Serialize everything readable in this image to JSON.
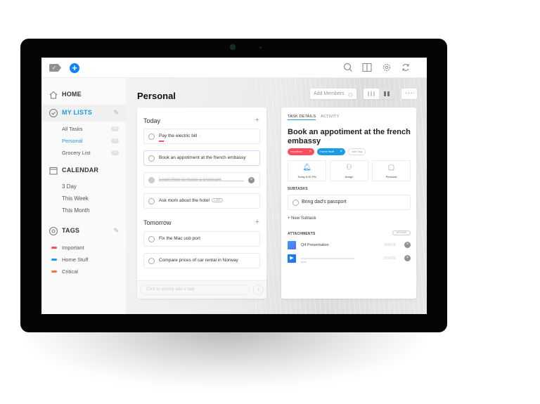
{
  "app": {
    "logo_glyph": "✓",
    "add_glyph": "+",
    "toolbar_icons": [
      "search-icon",
      "book-icon",
      "gear-icon",
      "sync-icon"
    ]
  },
  "sidebar": {
    "home": {
      "label": "HOME",
      "icon": "home-icon"
    },
    "my_lists": {
      "label": "MY LISTS",
      "icon": "check-circle-icon",
      "items": [
        {
          "label": "All Tasks",
          "count": "14"
        },
        {
          "label": "Personal",
          "count": "8",
          "active": true
        },
        {
          "label": "Grocery List",
          "count": "6"
        }
      ]
    },
    "calendar": {
      "label": "CALENDAR",
      "icon": "calendar-icon",
      "items": [
        {
          "label": "3 Day"
        },
        {
          "label": "This Week"
        },
        {
          "label": "This Month"
        }
      ]
    },
    "tags": {
      "label": "TAGS",
      "icon": "tag-icon",
      "items": [
        {
          "label": "Important",
          "color": "#ff4b5c"
        },
        {
          "label": "Home Stuff",
          "color": "#1a9be6"
        },
        {
          "label": "Critical",
          "color": "#ff7043"
        }
      ]
    }
  },
  "main": {
    "title": "Personal",
    "add_members_label": "Add Members",
    "more_label": "···",
    "sections": [
      {
        "title": "Today",
        "tasks": [
          {
            "text": "Pay the electric bill"
          },
          {
            "text": "Book an appotiment at the french embassy",
            "selected": true
          },
          {
            "text": "Learn how to make a croissant",
            "done": true
          },
          {
            "text": "Ask mom about the hotel",
            "chip": "1 APR"
          }
        ]
      },
      {
        "title": "Tomorrow",
        "tasks": [
          {
            "text": "Fix the Mac usb port"
          },
          {
            "text": "Compare prices of car rental in Norway"
          }
        ]
      }
    ],
    "quick_add_placeholder": "Click to quickly add a task"
  },
  "detail": {
    "tabs": [
      "TASK DETAILS",
      "ACTIVITY"
    ],
    "title": "Book an appotiment at the french embassy",
    "tags": [
      {
        "label": "Important",
        "color": "#ff4b5c"
      },
      {
        "label": "Home Stuff",
        "color": "#1a9be6"
      }
    ],
    "add_tag_label": "Add Tag",
    "actions": [
      {
        "label": "Today 6:30 PM",
        "icon": "bell-icon"
      },
      {
        "label": "Assign",
        "icon": "assign-icon"
      },
      {
        "label": "Personal",
        "icon": "list-icon"
      }
    ],
    "subtasks_label": "SUBTASKS",
    "subtasks": [
      {
        "text": "Bring dad's passport"
      }
    ],
    "new_subtask_label": "+ New Subtask",
    "attachments_label": "ATTACHMENTS",
    "upload_label": "UPLOAD",
    "attachments": [
      {
        "name": "Q4 Presentation",
        "date": "3/06/18",
        "type": "document"
      },
      {
        "name": "",
        "duration": "00:00",
        "date": "2/03/18",
        "type": "audio"
      }
    ]
  }
}
